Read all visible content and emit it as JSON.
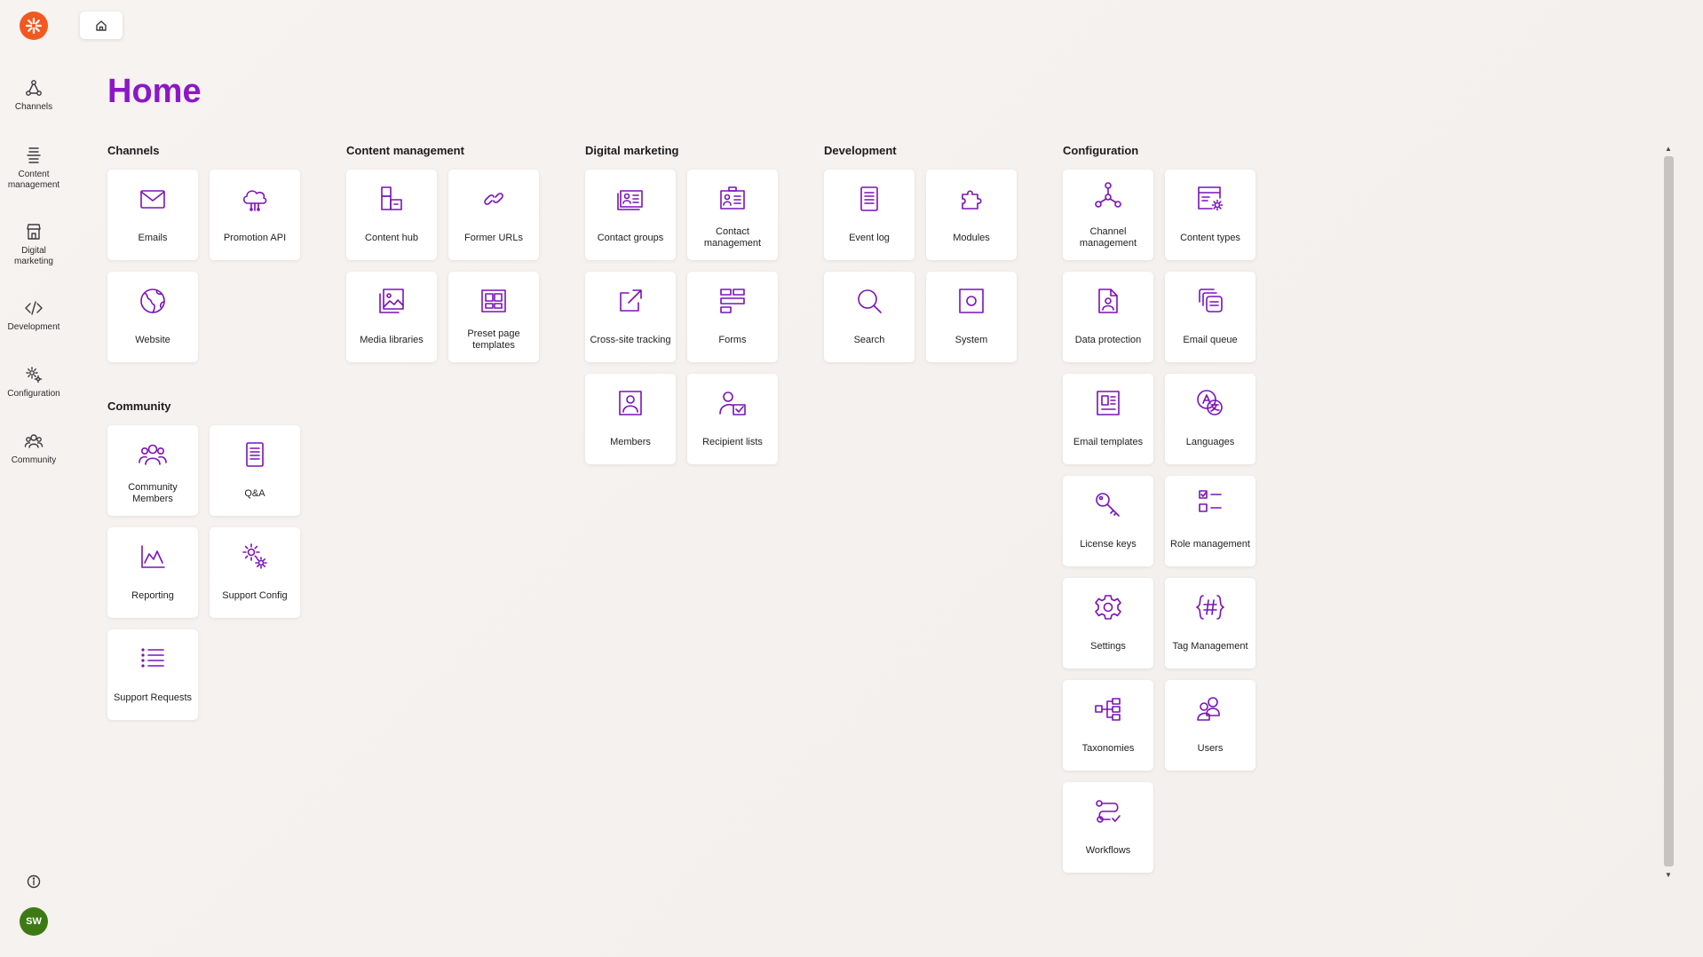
{
  "nav": {
    "items": [
      {
        "label": "Channels",
        "icon": "channels-icon"
      },
      {
        "label": "Content management",
        "icon": "content-management-icon"
      },
      {
        "label": "Digital marketing",
        "icon": "digital-marketing-icon"
      },
      {
        "label": "Development",
        "icon": "development-icon"
      },
      {
        "label": "Configuration",
        "icon": "configuration-icon"
      },
      {
        "label": "Community",
        "icon": "community-icon"
      }
    ],
    "avatar_initials": "SW"
  },
  "page": {
    "title": "Home"
  },
  "accent_color": "#8b17c6",
  "logo_color": "#f05a22",
  "sections": {
    "channels": {
      "title": "Channels",
      "tiles": [
        {
          "label": "Emails",
          "icon": "mail-icon"
        },
        {
          "label": "Promotion API",
          "icon": "cloud-icon"
        },
        {
          "label": "Website",
          "icon": "globe-icon"
        }
      ]
    },
    "community": {
      "title": "Community",
      "tiles": [
        {
          "label": "Community Members",
          "icon": "people-icon"
        },
        {
          "label": "Q&A",
          "icon": "document-icon"
        },
        {
          "label": "Reporting",
          "icon": "chart-icon"
        },
        {
          "label": "Support Config",
          "icon": "gears-icon"
        },
        {
          "label": "Support Requests",
          "icon": "list-icon"
        }
      ]
    },
    "content": {
      "title": "Content management",
      "tiles": [
        {
          "label": "Content hub",
          "icon": "content-hub-icon"
        },
        {
          "label": "Former URLs",
          "icon": "link-icon"
        },
        {
          "label": "Media libraries",
          "icon": "image-icon"
        },
        {
          "label": "Preset page templates",
          "icon": "layout-icon"
        }
      ]
    },
    "marketing": {
      "title": "Digital marketing",
      "tiles": [
        {
          "label": "Contact groups",
          "icon": "contact-groups-icon"
        },
        {
          "label": "Contact management",
          "icon": "contact-card-icon"
        },
        {
          "label": "Cross-site tracking",
          "icon": "external-link-icon"
        },
        {
          "label": "Forms",
          "icon": "form-icon"
        },
        {
          "label": "Members",
          "icon": "member-icon"
        },
        {
          "label": "Recipient lists",
          "icon": "recipient-list-icon"
        }
      ]
    },
    "development": {
      "title": "Development",
      "tiles": [
        {
          "label": "Event log",
          "icon": "event-log-icon"
        },
        {
          "label": "Modules",
          "icon": "puzzle-icon"
        },
        {
          "label": "Search",
          "icon": "search-icon"
        },
        {
          "label": "System",
          "icon": "system-icon"
        }
      ]
    },
    "configuration": {
      "title": "Configuration",
      "tiles": [
        {
          "label": "Channel management",
          "icon": "channel-management-icon"
        },
        {
          "label": "Content types",
          "icon": "content-types-icon"
        },
        {
          "label": "Data protection",
          "icon": "data-protection-icon"
        },
        {
          "label": "Email queue",
          "icon": "email-queue-icon"
        },
        {
          "label": "Email templates",
          "icon": "email-templates-icon"
        },
        {
          "label": "Languages",
          "icon": "languages-icon"
        },
        {
          "label": "License keys",
          "icon": "key-icon"
        },
        {
          "label": "Role management",
          "icon": "role-management-icon"
        },
        {
          "label": "Settings",
          "icon": "gear-icon"
        },
        {
          "label": "Tag Management",
          "icon": "tag-management-icon"
        },
        {
          "label": "Taxonomies",
          "icon": "taxonomy-icon"
        },
        {
          "label": "Users",
          "icon": "users-icon"
        },
        {
          "label": "Workflows",
          "icon": "workflow-icon"
        }
      ]
    }
  }
}
